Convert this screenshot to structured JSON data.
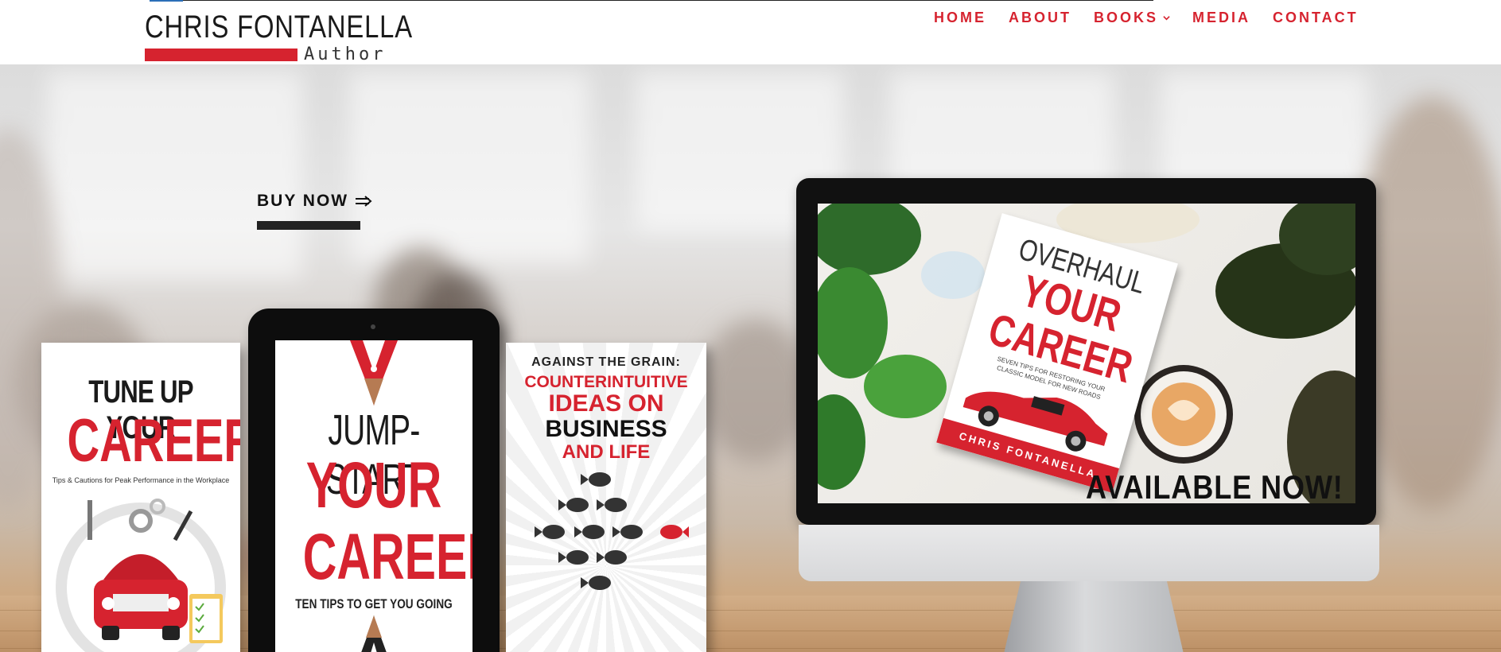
{
  "header": {
    "logo": {
      "name": "CHRIS FONTANELLA",
      "subtitle": "Author"
    },
    "nav": [
      {
        "label": "HOME"
      },
      {
        "label": "ABOUT"
      },
      {
        "label": "BOOKS",
        "has_dropdown": true
      },
      {
        "label": "MEDIA"
      },
      {
        "label": "CONTACT"
      }
    ]
  },
  "hero": {
    "cta_label": "BUY NOW",
    "books": [
      {
        "line1": "TUNE UP YOUR",
        "line2": "CAREER",
        "tagline": "Tips & Cautions for Peak Performance in the Workplace"
      },
      {
        "line1": "JUMP-START",
        "line2": "YOUR",
        "line3": "CAREER",
        "tagline": "TEN TIPS TO GET YOU GOING"
      },
      {
        "line1": "AGAINST THE GRAIN:",
        "line2": "COUNTERINTUITIVE",
        "line3": "IDEAS ON",
        "line4": "BUSINESS",
        "line5": "AND LIFE"
      }
    ],
    "monitor": {
      "book": {
        "line1": "OVERHAUL",
        "line2": "YOUR",
        "line3": "CAREER",
        "tagline": "SEVEN TIPS FOR RESTORING YOUR CLASSIC MODEL FOR NEW ROADS",
        "author": "CHRIS FONTANELLA"
      },
      "banner": "AVAILABLE NOW!"
    }
  },
  "colors": {
    "accent": "#d6232f",
    "text_dark": "#1a1a1a"
  },
  "icons": {
    "books_dropdown": "chevron-down-icon",
    "cta_arrow": "arrow-right-icon"
  }
}
